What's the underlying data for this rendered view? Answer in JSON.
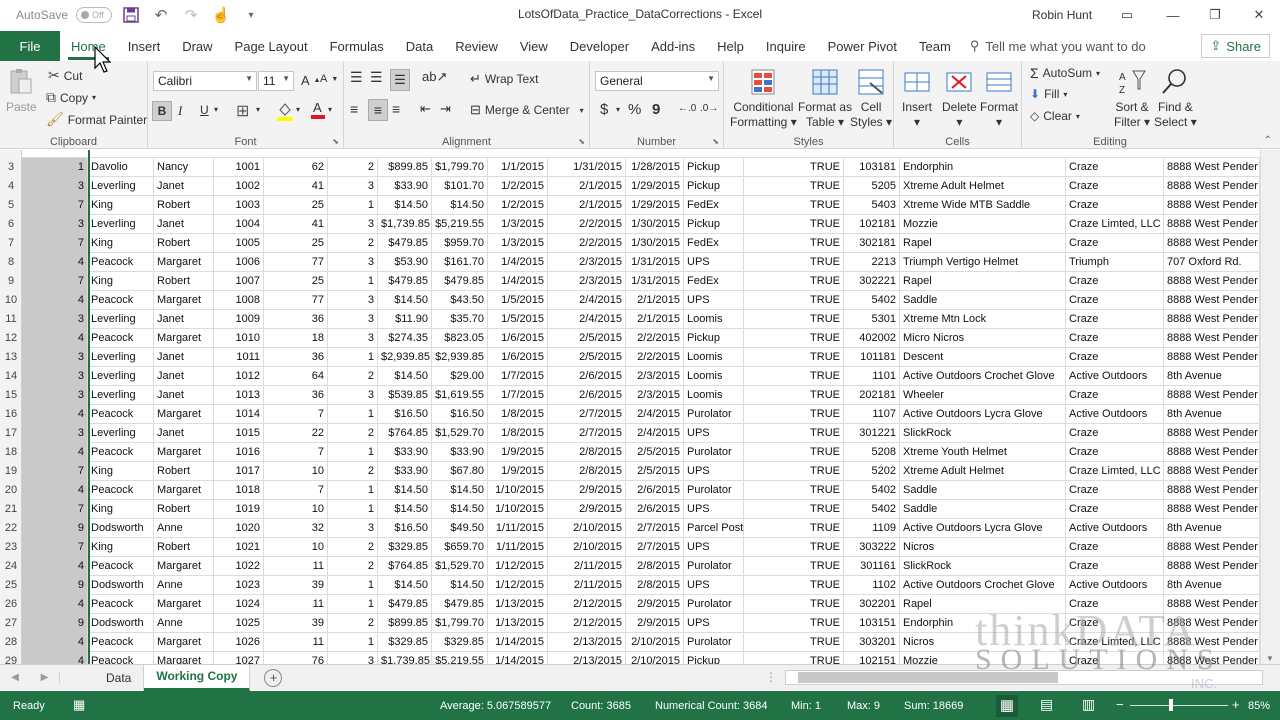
{
  "title_bar": {
    "autosave_label": "AutoSave",
    "autosave_state": "Off",
    "document_title": "LotsOfData_Practice_DataCorrections  -  Excel",
    "user_name": "Robin Hunt"
  },
  "tabs": {
    "file": "File",
    "items": [
      "Home",
      "Insert",
      "Draw",
      "Page Layout",
      "Formulas",
      "Data",
      "Review",
      "View",
      "Developer",
      "Add-ins",
      "Help",
      "Inquire",
      "Power Pivot",
      "Team"
    ],
    "active": "Home",
    "tell_me": "Tell me what you want to do",
    "share": "Share"
  },
  "ribbon": {
    "clipboard": {
      "paste": "Paste",
      "cut": "Cut",
      "copy": "Copy",
      "format_painter": "Format Painter",
      "label": "Clipboard"
    },
    "font": {
      "name": "Calibri",
      "size": "11",
      "bold": "B",
      "italic": "I",
      "underline": "U",
      "label": "Font"
    },
    "alignment": {
      "wrap_text": "Wrap Text",
      "merge_center": "Merge & Center",
      "label": "Alignment"
    },
    "number": {
      "format": "General",
      "currency": "$",
      "percent": "%",
      "comma": "9",
      "label": "Number"
    },
    "styles": {
      "conditional": "Conditional",
      "conditional2": "Formatting",
      "format_as": "Format as",
      "format_as2": "Table",
      "cell_styles": "Cell",
      "cell_styles2": "Styles",
      "label": "Styles"
    },
    "cells": {
      "insert": "Insert",
      "delete": "Delete",
      "format": "Format",
      "label": "Cells"
    },
    "editing": {
      "autosum": "AutoSum",
      "fill": "Fill",
      "clear": "Clear",
      "sort": "Sort &",
      "sort2": "Filter",
      "find": "Find &",
      "find2": "Select",
      "label": "Editing"
    }
  },
  "sheet": {
    "rows": [
      {
        "n": "3",
        "c": [
          "1",
          "Davolio",
          "Nancy",
          "1001",
          "62",
          "2",
          "$899.85",
          "$1,799.70",
          "1/1/2015",
          "1/31/2015",
          "1/28/2015",
          "Pickup",
          "TRUE",
          "103181",
          "Endorphin",
          "Craze",
          "8888 West Pender"
        ]
      },
      {
        "n": "4",
        "c": [
          "3",
          "Leverling",
          "Janet",
          "1002",
          "41",
          "3",
          "$33.90",
          "$101.70",
          "1/2/2015",
          "2/1/2015",
          "1/29/2015",
          "Pickup",
          "TRUE",
          "5205",
          "Xtreme Adult Helmet",
          "Craze",
          "8888 West Pender"
        ]
      },
      {
        "n": "5",
        "c": [
          "7",
          "King",
          "Robert",
          "1003",
          "25",
          "1",
          "$14.50",
          "$14.50",
          "1/2/2015",
          "2/1/2015",
          "1/29/2015",
          "FedEx",
          "TRUE",
          "5403",
          "Xtreme Wide MTB Saddle",
          "Craze",
          "8888 West Pender"
        ]
      },
      {
        "n": "6",
        "c": [
          "3",
          "Leverling",
          "Janet",
          "1004",
          "41",
          "3",
          "$1,739.85",
          "$5,219.55",
          "1/3/2015",
          "2/2/2015",
          "1/30/2015",
          "Pickup",
          "TRUE",
          "102181",
          "Mozzie",
          "Craze Limted, LLC",
          "8888 West Pender"
        ]
      },
      {
        "n": "7",
        "c": [
          "7",
          "King",
          "Robert",
          "1005",
          "25",
          "2",
          "$479.85",
          "$959.70",
          "1/3/2015",
          "2/2/2015",
          "1/30/2015",
          "FedEx",
          "TRUE",
          "302181",
          "Rapel",
          "Craze",
          "8888 West Pender"
        ]
      },
      {
        "n": "8",
        "c": [
          "4",
          "Peacock",
          "Margaret",
          "1006",
          "77",
          "3",
          "$53.90",
          "$161.70",
          "1/4/2015",
          "2/3/2015",
          "1/31/2015",
          "UPS",
          "TRUE",
          "2213",
          "Triumph Vertigo Helmet",
          "Triumph",
          "707 Oxford Rd."
        ]
      },
      {
        "n": "9",
        "c": [
          "7",
          "King",
          "Robert",
          "1007",
          "25",
          "1",
          "$479.85",
          "$479.85",
          "1/4/2015",
          "2/3/2015",
          "1/31/2015",
          "FedEx",
          "TRUE",
          "302221",
          "Rapel",
          "Craze",
          "8888 West Pender"
        ]
      },
      {
        "n": "10",
        "c": [
          "4",
          "Peacock",
          "Margaret",
          "1008",
          "77",
          "3",
          "$14.50",
          "$43.50",
          "1/5/2015",
          "2/4/2015",
          "2/1/2015",
          "UPS",
          "TRUE",
          "5402",
          "Saddle",
          "Craze",
          "8888 West Pender"
        ]
      },
      {
        "n": "11",
        "c": [
          "3",
          "Leverling",
          "Janet",
          "1009",
          "36",
          "3",
          "$11.90",
          "$35.70",
          "1/5/2015",
          "2/4/2015",
          "2/1/2015",
          "Loomis",
          "TRUE",
          "5301",
          "Xtreme Mtn Lock",
          "Craze",
          "8888 West Pender"
        ]
      },
      {
        "n": "12",
        "c": [
          "4",
          "Peacock",
          "Margaret",
          "1010",
          "18",
          "3",
          "$274.35",
          "$823.05",
          "1/6/2015",
          "2/5/2015",
          "2/2/2015",
          "Pickup",
          "TRUE",
          "402002",
          "Micro Nicros",
          "Craze",
          "8888 West Pender"
        ]
      },
      {
        "n": "13",
        "c": [
          "3",
          "Leverling",
          "Janet",
          "1011",
          "36",
          "1",
          "$2,939.85",
          "$2,939.85",
          "1/6/2015",
          "2/5/2015",
          "2/2/2015",
          "Loomis",
          "TRUE",
          "101181",
          "Descent",
          "Craze",
          "8888 West Pender"
        ]
      },
      {
        "n": "14",
        "c": [
          "3",
          "Leverling",
          "Janet",
          "1012",
          "64",
          "2",
          "$14.50",
          "$29.00",
          "1/7/2015",
          "2/6/2015",
          "2/3/2015",
          "Loomis",
          "TRUE",
          "1101",
          "Active Outdoors Crochet Glove",
          "Active Outdoors",
          "8th Avenue"
        ]
      },
      {
        "n": "15",
        "c": [
          "3",
          "Leverling",
          "Janet",
          "1013",
          "36",
          "3",
          "$539.85",
          "$1,619.55",
          "1/7/2015",
          "2/6/2015",
          "2/3/2015",
          "Loomis",
          "TRUE",
          "202181",
          "Wheeler",
          "Craze",
          "8888 West Pender"
        ]
      },
      {
        "n": "16",
        "c": [
          "4",
          "Peacock",
          "Margaret",
          "1014",
          "7",
          "1",
          "$16.50",
          "$16.50",
          "1/8/2015",
          "2/7/2015",
          "2/4/2015",
          "Purolator",
          "TRUE",
          "1107",
          "Active Outdoors Lycra Glove",
          "Active Outdoors",
          "8th Avenue"
        ]
      },
      {
        "n": "17",
        "c": [
          "3",
          "Leverling",
          "Janet",
          "1015",
          "22",
          "2",
          "$764.85",
          "$1,529.70",
          "1/8/2015",
          "2/7/2015",
          "2/4/2015",
          "UPS",
          "TRUE",
          "301221",
          "SlickRock",
          "Craze",
          "8888 West Pender"
        ]
      },
      {
        "n": "18",
        "c": [
          "4",
          "Peacock",
          "Margaret",
          "1016",
          "7",
          "1",
          "$33.90",
          "$33.90",
          "1/9/2015",
          "2/8/2015",
          "2/5/2015",
          "Purolator",
          "TRUE",
          "5208",
          "Xtreme Youth Helmet",
          "Craze",
          "8888 West Pender"
        ]
      },
      {
        "n": "19",
        "c": [
          "7",
          "King",
          "Robert",
          "1017",
          "10",
          "2",
          "$33.90",
          "$67.80",
          "1/9/2015",
          "2/8/2015",
          "2/5/2015",
          "UPS",
          "TRUE",
          "5202",
          "Xtreme Adult Helmet",
          "Craze Limted, LLC",
          "8888 West Pender"
        ]
      },
      {
        "n": "20",
        "c": [
          "4",
          "Peacock",
          "Margaret",
          "1018",
          "7",
          "1",
          "$14.50",
          "$14.50",
          "1/10/2015",
          "2/9/2015",
          "2/6/2015",
          "Purolator",
          "TRUE",
          "5402",
          "Saddle",
          "Craze",
          "8888 West Pender"
        ]
      },
      {
        "n": "21",
        "c": [
          "7",
          "King",
          "Robert",
          "1019",
          "10",
          "1",
          "$14.50",
          "$14.50",
          "1/10/2015",
          "2/9/2015",
          "2/6/2015",
          "UPS",
          "TRUE",
          "5402",
          "Saddle",
          "Craze",
          "8888 West Pender"
        ]
      },
      {
        "n": "22",
        "c": [
          "9",
          "Dodsworth",
          "Anne",
          "1020",
          "32",
          "3",
          "$16.50",
          "$49.50",
          "1/11/2015",
          "2/10/2015",
          "2/7/2015",
          "Parcel Post",
          "TRUE",
          "1109",
          "Active Outdoors Lycra Glove",
          "Active Outdoors",
          "8th Avenue"
        ]
      },
      {
        "n": "23",
        "c": [
          "7",
          "King",
          "Robert",
          "1021",
          "10",
          "2",
          "$329.85",
          "$659.70",
          "1/11/2015",
          "2/10/2015",
          "2/7/2015",
          "UPS",
          "TRUE",
          "303222",
          "Nicros",
          "Craze",
          "8888 West Pender"
        ]
      },
      {
        "n": "24",
        "c": [
          "4",
          "Peacock",
          "Margaret",
          "1022",
          "11",
          "2",
          "$764.85",
          "$1,529.70",
          "1/12/2015",
          "2/11/2015",
          "2/8/2015",
          "Purolator",
          "TRUE",
          "301161",
          "SlickRock",
          "Craze",
          "8888 West Pender"
        ]
      },
      {
        "n": "25",
        "c": [
          "9",
          "Dodsworth",
          "Anne",
          "1023",
          "39",
          "1",
          "$14.50",
          "$14.50",
          "1/12/2015",
          "2/11/2015",
          "2/8/2015",
          "UPS",
          "TRUE",
          "1102",
          "Active Outdoors Crochet Glove",
          "Active Outdoors",
          "8th Avenue"
        ]
      },
      {
        "n": "26",
        "c": [
          "4",
          "Peacock",
          "Margaret",
          "1024",
          "11",
          "1",
          "$479.85",
          "$479.85",
          "1/13/2015",
          "2/12/2015",
          "2/9/2015",
          "Purolator",
          "TRUE",
          "302201",
          "Rapel",
          "Craze",
          "8888 West Pender"
        ]
      },
      {
        "n": "27",
        "c": [
          "9",
          "Dodsworth",
          "Anne",
          "1025",
          "39",
          "2",
          "$899.85",
          "$1,799.70",
          "1/13/2015",
          "2/12/2015",
          "2/9/2015",
          "UPS",
          "TRUE",
          "103151",
          "Endorphin",
          "Craze",
          "8888 West Pender"
        ]
      },
      {
        "n": "28",
        "c": [
          "4",
          "Peacock",
          "Margaret",
          "1026",
          "11",
          "1",
          "$329.85",
          "$329.85",
          "1/14/2015",
          "2/13/2015",
          "2/10/2015",
          "Purolator",
          "TRUE",
          "303201",
          "Nicros",
          "Craze Limted, LLC",
          "8888 West Pender"
        ]
      },
      {
        "n": "29",
        "c": [
          "4",
          "Peacock",
          "Margaret",
          "1027",
          "76",
          "3",
          "$1,739.85",
          "$5,219.55",
          "1/14/2015",
          "2/13/2015",
          "2/10/2015",
          "Pickup",
          "TRUE",
          "102151",
          "Mozzie",
          "Craze",
          "8888 West Pender"
        ]
      }
    ]
  },
  "sheet_tabs": {
    "items": [
      "Data",
      "Working Copy"
    ],
    "active": "Working Copy"
  },
  "status": {
    "ready": "Ready",
    "average": "Average: 5.067589577",
    "count": "Count: 3685",
    "numerical_count": "Numerical Count: 3684",
    "min": "Min: 1",
    "max": "Max: 9",
    "sum": "Sum: 18669",
    "zoom": "85%"
  },
  "watermark": {
    "line1": "thinkDATA",
    "line2": "SOLUTIONS",
    "line3": "INC."
  },
  "colors": {
    "accent": "#217346",
    "selected_column": "#c9c9c9"
  }
}
